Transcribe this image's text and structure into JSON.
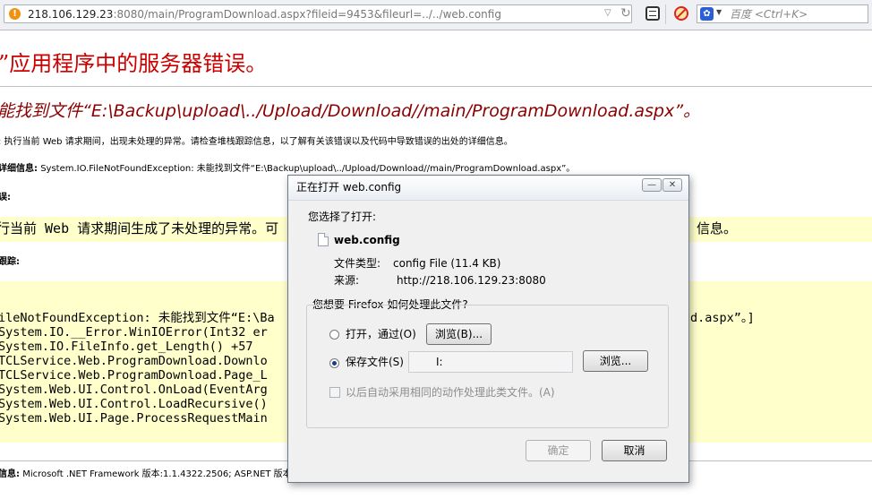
{
  "browser": {
    "url_host": "218.106.129.23",
    "url_rest": ":8080/main/ProgramDownload.aspx?fileid=9453&fileurl=../../web.config",
    "search_placeholder": "百度 <Ctrl+K>",
    "accent_warning": "#f29111"
  },
  "error_page": {
    "title": "”应用程序中的服务器错误。",
    "subtitle": "能找到文件“E:\\Backup\\upload\\../Upload/Download//main/ProgramDownload.aspx”。",
    "description": ": 执行当前 Web 请求期间，出现未处理的异常。请检查堆栈跟踪信息，以了解有关该错误以及代码中导致错误的出处的详细信息。",
    "detail_label": "详细信息:",
    "detail_text": "System.IO.FileNotFoundException: 未能找到文件“E:\\Backup\\upload\\../Upload/Download//main/ProgramDownload.aspx”。",
    "source_label": "误:",
    "box_line_left": "行当前 Web 请求期间生成了未处理的异常。可",
    "box_line_right": "信息。",
    "stack_label": "跟踪:",
    "stack_lines": [
      "ileNotFoundException: 未能找到文件“E:\\Ba",
      " System.IO.__Error.WinIOError(Int32 er",
      " System.IO.FileInfo.get_Length() +57",
      " TCLService.Web.ProgramDownload.Downlo",
      " TCLService.Web.ProgramDownload.Page_L",
      " System.Web.UI.Control.OnLoad(EventArg",
      " System.Web.UI.Control.LoadRecursive()",
      " System.Web.UI.Page.ProcessRequestMain"
    ],
    "stack_line_tail": "d.aspx”。]",
    "version_label": "信息:",
    "version_text": "Microsoft .NET Framework 版本:1.1.4322.2506; ASP.NET 版本"
  },
  "dialog": {
    "title": "正在打开 web.config",
    "chose_to_open": "您选择了打开:",
    "file_name": "web.config",
    "type_label": "文件类型:",
    "type_value": "config File (11.4 KB)",
    "source_label": "来源:",
    "source_value": "http://218.106.129.23:8080",
    "question": "您想要 Firefox 如何处理此文件?",
    "open_with_label": "打开，通过(O)",
    "browse_b_label": "浏览(B)...",
    "save_file_label": "保存文件(S)",
    "save_path": "I:",
    "browse_label": "浏览...",
    "auto_action_label": "以后自动采用相同的动作处理此类文件。(A)",
    "ok_label": "确定",
    "cancel_label": "取消",
    "minimize_icon": "—",
    "close_icon": "✕"
  }
}
